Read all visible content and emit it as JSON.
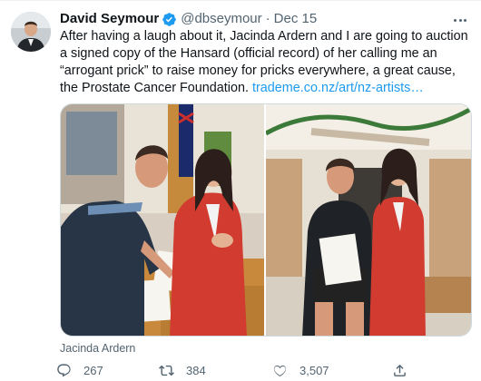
{
  "tweet": {
    "author_name": "David Seymour",
    "handle": "@dbseymour",
    "date": "Dec 15",
    "text_main": "After having a laugh about it, Jacinda Ardern and I are going to auction a signed copy of the Hansard (official record) of her calling me an “arrogant prick” to raise money for pricks everywhere, a great cause, the Prostate Cancer Foundation. ",
    "link_text": "trademe.co.nz/art/nz-artists…",
    "media_caption": "Jacinda Ardern"
  },
  "actions": {
    "replies": "267",
    "retweets": "384",
    "likes": "3,507"
  },
  "icons": {
    "verified": "verified-badge-icon",
    "more": "more-options-icon",
    "reply": "reply-icon",
    "retweet": "retweet-icon",
    "like": "heart-icon",
    "share": "share-icon"
  },
  "colors": {
    "accent": "#1d9bf0",
    "text": "#0f1419",
    "secondary": "#536471"
  }
}
